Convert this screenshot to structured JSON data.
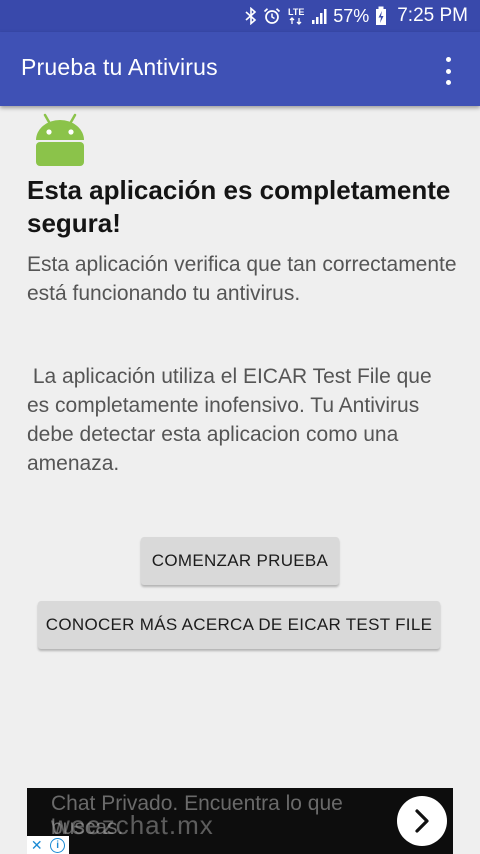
{
  "status_bar": {
    "battery": "57%",
    "time": "7:25 PM",
    "network": "LTE",
    "icons": [
      "bluetooth-icon",
      "alarm-icon",
      "lte-icon",
      "signal-icon",
      "battery-icon"
    ]
  },
  "app_bar": {
    "title": "Prueba tu Antivirus",
    "menu_icon": "overflow-menu-icon"
  },
  "content": {
    "logo_icon": "android-logo-icon",
    "heading": "Esta aplicación es completamente segura!",
    "paragraph_1": "Esta aplicación verifica que tan correctamente está funcionando tu antivirus.",
    "paragraph_2": " La aplicación utiliza el EICAR Test File que es completamente inofensivo. Tu Antivirus debe detectar esta aplicacion como una amenaza."
  },
  "buttons": {
    "start_label": "COMENZAR PRUEBA",
    "learn_more_label": "CONOCER MÁS ACERCA DE EICAR TEST FILE"
  },
  "ad": {
    "text": "Chat Privado. Encuentra lo que buscas.",
    "watermark": "weezchat.mx",
    "arrow_icon": "chevron-right-icon",
    "choices_icon": "ad-choices-icon"
  },
  "colors": {
    "status_bar": "#3949ab",
    "app_bar": "#3f51b5",
    "android_green": "#8bc34a",
    "background": "#efefef",
    "button": "#d9d9d9"
  }
}
